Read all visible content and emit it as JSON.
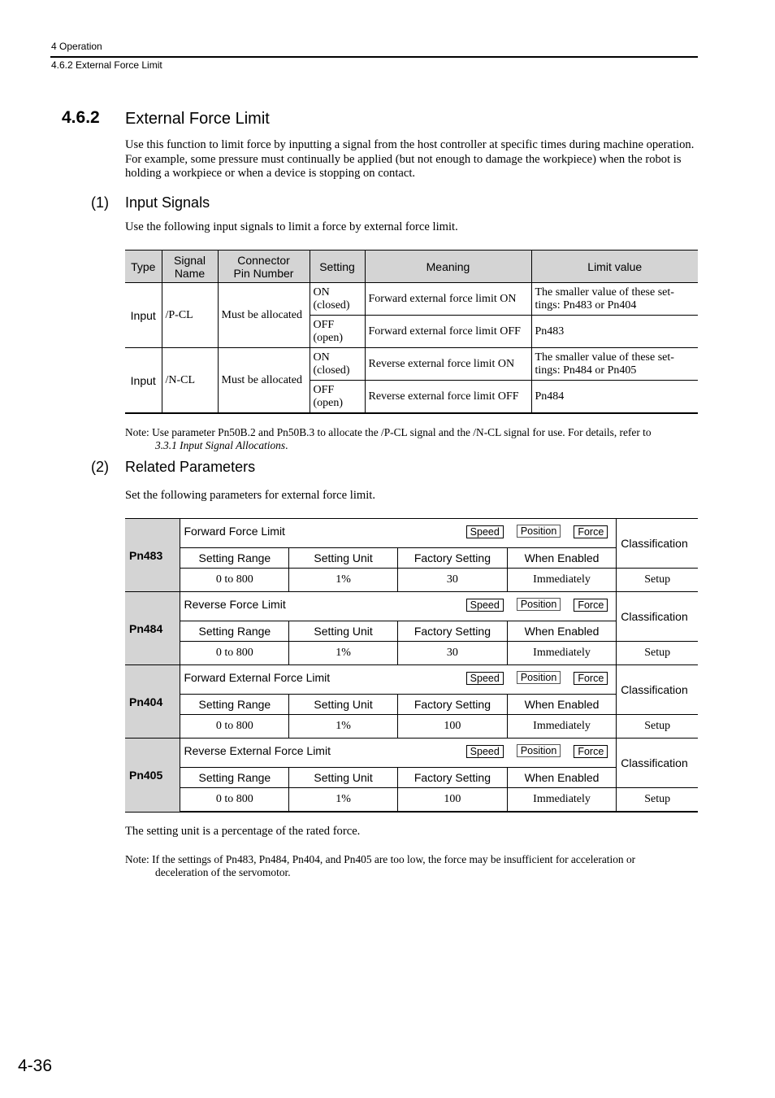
{
  "header": {
    "chapter": "4  Operation",
    "section": "4.6.2  External Force Limit"
  },
  "section": {
    "number": "4.6.2",
    "title": "External Force Limit",
    "intro": "Use this function to limit force by inputting a signal from the host controller at specific times during machine operation. For example, some pressure must continually be applied (but not enough to damage the workpiece) when the robot is holding a workpiece or when a device is stopping on contact."
  },
  "input_signals": {
    "number": "(1)",
    "title": "Input Signals",
    "description": "Use the following input signals to limit a force by external force limit.",
    "columns": [
      "Type",
      "Signal Name",
      "Connector Pin Number",
      "Setting",
      "Meaning",
      "Limit value"
    ],
    "column_lines": [
      [
        "Type"
      ],
      [
        "Signal",
        "Name"
      ],
      [
        "Connector",
        "Pin Number"
      ],
      [
        "Setting"
      ],
      [
        "Meaning"
      ],
      [
        "Limit value"
      ]
    ],
    "groups": [
      {
        "type": "Input",
        "signal": "/P-CL",
        "pin": "Must be allocated",
        "rows": [
          {
            "setting_line1": "ON",
            "setting_line2": "(closed)",
            "meaning": "Forward external force limit ON",
            "limit": "The smaller value of these set-tings: Pn483 or Pn404",
            "limit_line1": "The smaller value of these set-",
            "limit_line2": "tings: Pn483 or Pn404"
          },
          {
            "setting_line1": "OFF",
            "setting_line2": "(open)",
            "meaning": "Forward external force limit OFF",
            "limit": "Pn483",
            "limit_line1": "Pn483",
            "limit_line2": ""
          }
        ]
      },
      {
        "type": "Input",
        "signal": "/N-CL",
        "pin": "Must be allocated",
        "rows": [
          {
            "setting_line1": "ON",
            "setting_line2": "(closed)",
            "meaning": "Reverse external force limit ON",
            "limit": "The smaller value of these set-tings: Pn484 or Pn405",
            "limit_line1": "The smaller value of these set-",
            "limit_line2": "tings: Pn484 or Pn405"
          },
          {
            "setting_line1": "OFF",
            "setting_line2": "(open)",
            "meaning": "Reverse external force limit OFF",
            "limit": "Pn484",
            "limit_line1": "Pn484",
            "limit_line2": ""
          }
        ]
      }
    ],
    "note_label": "Note:",
    "note_text": "Use parameter Pn50B.2 and Pn50B.3 to allocate the /P-CL signal and the /N-CL signal for use. For details, refer to",
    "note_ref": "3.3.1 Input Signal Allocations",
    "note_end": "."
  },
  "related_parameters": {
    "number": "(2)",
    "title": "Related Parameters",
    "description": "Set the following parameters for external force limit.",
    "header_labels": {
      "setting_range": "Setting Range",
      "setting_unit": "Setting Unit",
      "factory_setting": "Factory Setting",
      "when_enabled": "When Enabled",
      "classification": "Classification"
    },
    "tags": [
      "Speed",
      "Position",
      "Force"
    ],
    "params": [
      {
        "id": "Pn483",
        "name": "Forward Force Limit",
        "range": "0 to 800",
        "unit": "1%",
        "factory": "30",
        "enabled": "Immediately",
        "classification": "Setup"
      },
      {
        "id": "Pn484",
        "name": "Reverse Force Limit",
        "range": "0 to 800",
        "unit": "1%",
        "factory": "30",
        "enabled": "Immediately",
        "classification": "Setup"
      },
      {
        "id": "Pn404",
        "name": "Forward External Force Limit",
        "range": "0 to 800",
        "unit": "1%",
        "factory": "100",
        "enabled": "Immediately",
        "classification": "Setup"
      },
      {
        "id": "Pn405",
        "name": "Reverse External Force Limit",
        "range": "0 to 800",
        "unit": "1%",
        "factory": "100",
        "enabled": "Immediately",
        "classification": "Setup"
      }
    ],
    "unit_note": "The setting unit is a percentage of the rated force.",
    "note_label": "Note:",
    "note_line1": "If the settings of Pn483, Pn484, Pn404, and Pn405 are too low, the force may be insufficient for acceleration or",
    "note_line2": "deceleration of the servomotor."
  },
  "page_number": "4-36"
}
